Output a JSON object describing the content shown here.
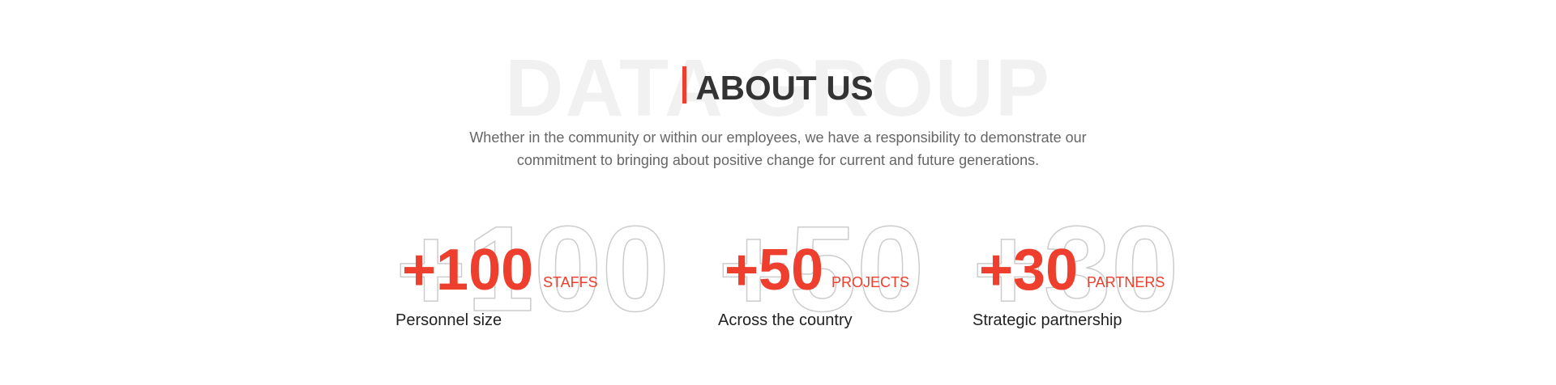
{
  "header": {
    "background_word": "DATA GROUP",
    "title": "ABOUT US",
    "description": "Whether in the community or within our employees, we have a responsibility to demonstrate our commitment to bringing about positive change for current and future generations."
  },
  "stats": [
    {
      "ghost": "+100",
      "value": "+100",
      "unit": "STAFFS",
      "label": "Personnel size"
    },
    {
      "ghost": "+50",
      "value": "+50",
      "unit": "PROJECTS",
      "label": "Across the country"
    },
    {
      "ghost": "+30",
      "value": "+30",
      "unit": "PARTNERS",
      "label": "Strategic partnership"
    }
  ],
  "colors": {
    "accent": "#ee3e2d",
    "title": "#333333",
    "text": "#666666",
    "ghost_stroke": "#cccccc"
  }
}
